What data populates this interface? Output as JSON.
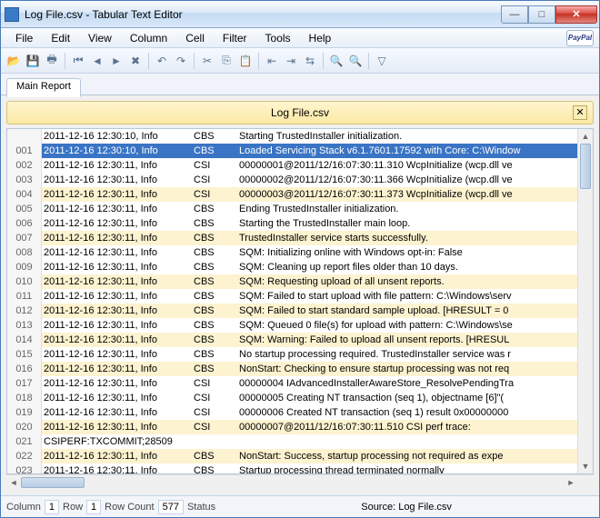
{
  "window": {
    "title": "Log File.csv - Tabular Text Editor"
  },
  "menu": {
    "file": "File",
    "edit": "Edit",
    "view": "View",
    "column": "Column",
    "cell": "Cell",
    "filter": "Filter",
    "tools": "Tools",
    "help": "Help",
    "paypal": "PayPal"
  },
  "tab": {
    "main": "Main Report"
  },
  "banner": {
    "filename": "Log File.csv"
  },
  "header": {
    "c1": "2011-12-16 12:30:10, Info",
    "c2": "CBS",
    "c3": "Starting TrustedInstaller initialization."
  },
  "rows": [
    {
      "n": "001",
      "c1": "2011-12-16 12:30:10, Info",
      "c2": "CBS",
      "c3": "Loaded Servicing Stack v6.1.7601.17592 with Core: C:\\Window",
      "sel": true
    },
    {
      "n": "002",
      "c1": "2011-12-16 12:30:11, Info",
      "c2": "CSI",
      "c3": "00000001@2011/12/16:07:30:11.310 WcpInitialize (wcp.dll ve"
    },
    {
      "n": "003",
      "c1": "2011-12-16 12:30:11, Info",
      "c2": "CSI",
      "c3": "00000002@2011/12/16:07:30:11.366 WcpInitialize (wcp.dll ve"
    },
    {
      "n": "004",
      "c1": "2011-12-16 12:30:11, Info",
      "c2": "CSI",
      "c3": "00000003@2011/12/16:07:30:11.373 WcpInitialize (wcp.dll ve",
      "alt": true
    },
    {
      "n": "005",
      "c1": "2011-12-16 12:30:11, Info",
      "c2": "CBS",
      "c3": "Ending TrustedInstaller initialization."
    },
    {
      "n": "006",
      "c1": "2011-12-16 12:30:11, Info",
      "c2": "CBS",
      "c3": "Starting the TrustedInstaller main loop."
    },
    {
      "n": "007",
      "c1": "2011-12-16 12:30:11, Info",
      "c2": "CBS",
      "c3": "TrustedInstaller service starts successfully.",
      "alt": true
    },
    {
      "n": "008",
      "c1": "2011-12-16 12:30:11, Info",
      "c2": "CBS",
      "c3": "SQM: Initializing online with Windows opt-in: False"
    },
    {
      "n": "009",
      "c1": "2011-12-16 12:30:11, Info",
      "c2": "CBS",
      "c3": "SQM: Cleaning up report files older than 10 days."
    },
    {
      "n": "010",
      "c1": "2011-12-16 12:30:11, Info",
      "c2": "CBS",
      "c3": "SQM: Requesting upload of all unsent reports.",
      "alt": true
    },
    {
      "n": "011",
      "c1": "2011-12-16 12:30:11, Info",
      "c2": "CBS",
      "c3": "SQM: Failed to start upload with file pattern: C:\\Windows\\serv"
    },
    {
      "n": "012",
      "c1": "2011-12-16 12:30:11, Info",
      "c2": "CBS",
      "c3": "SQM: Failed to start standard sample upload. [HRESULT = 0",
      "alt": true
    },
    {
      "n": "013",
      "c1": "2011-12-16 12:30:11, Info",
      "c2": "CBS",
      "c3": "SQM: Queued 0 file(s) for upload with pattern: C:\\Windows\\se"
    },
    {
      "n": "014",
      "c1": "2011-12-16 12:30:11, Info",
      "c2": "CBS",
      "c3": "SQM: Warning: Failed to upload all unsent reports. [HRESUL",
      "alt": true
    },
    {
      "n": "015",
      "c1": "2011-12-16 12:30:11, Info",
      "c2": "CBS",
      "c3": "No startup processing required. TrustedInstaller service was r"
    },
    {
      "n": "016",
      "c1": "2011-12-16 12:30:11, Info",
      "c2": "CBS",
      "c3": "NonStart: Checking to ensure startup processing was not req",
      "alt": true
    },
    {
      "n": "017",
      "c1": "2011-12-16 12:30:11, Info",
      "c2": "CSI",
      "c3": "00000004 IAdvancedInstallerAwareStore_ResolvePendingTra"
    },
    {
      "n": "018",
      "c1": "2011-12-16 12:30:11, Info",
      "c2": "CSI",
      "c3": "00000005 Creating NT transaction (seq 1), objectname [6]\"("
    },
    {
      "n": "019",
      "c1": "2011-12-16 12:30:11, Info",
      "c2": "CSI",
      "c3": "00000006 Created NT transaction (seq 1) result 0x00000000"
    },
    {
      "n": "020",
      "c1": "2011-12-16 12:30:11, Info",
      "c2": "CSI",
      "c3": "00000007@2011/12/16:07:30:11.510 CSI perf trace:",
      "alt": true
    },
    {
      "n": "021",
      "c1": "CSIPERF:TXCOMMIT;28509",
      "c2": "",
      "c3": ""
    },
    {
      "n": "022",
      "c1": "2011-12-16 12:30:11, Info",
      "c2": "CBS",
      "c3": "NonStart: Success, startup processing not required as expe",
      "alt": true
    },
    {
      "n": "023",
      "c1": "2011-12-16 12:30:11, Info",
      "c2": "CBS",
      "c3": "Startup processing thread terminated normally"
    }
  ],
  "status": {
    "columnLabel": "Column",
    "columnVal": "1",
    "rowLabel": "Row",
    "rowVal": "1",
    "rowCountLabel": "Row Count",
    "rowCountVal": "577",
    "statusLabel": "Status",
    "source": "Source: Log File.csv"
  }
}
